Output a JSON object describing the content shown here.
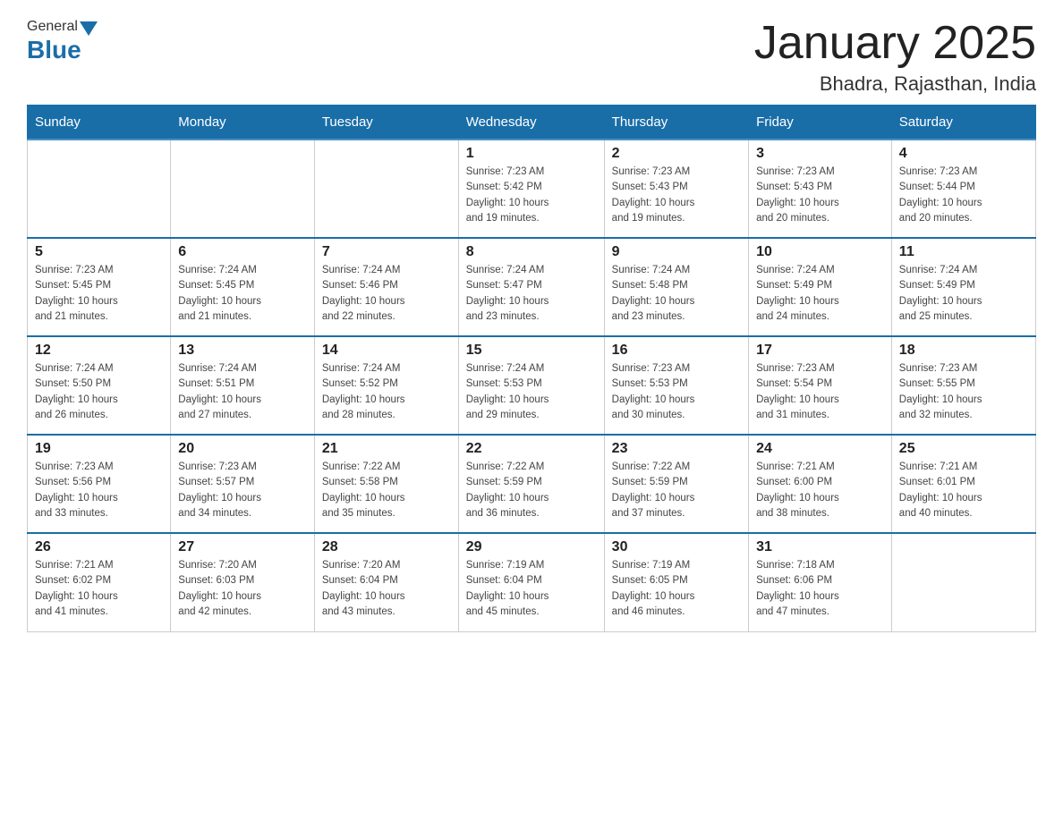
{
  "header": {
    "logo_general": "General",
    "logo_blue": "Blue",
    "month_title": "January 2025",
    "location": "Bhadra, Rajasthan, India"
  },
  "days_of_week": [
    "Sunday",
    "Monday",
    "Tuesday",
    "Wednesday",
    "Thursday",
    "Friday",
    "Saturday"
  ],
  "weeks": [
    [
      {
        "day": "",
        "info": ""
      },
      {
        "day": "",
        "info": ""
      },
      {
        "day": "",
        "info": ""
      },
      {
        "day": "1",
        "info": "Sunrise: 7:23 AM\nSunset: 5:42 PM\nDaylight: 10 hours\nand 19 minutes."
      },
      {
        "day": "2",
        "info": "Sunrise: 7:23 AM\nSunset: 5:43 PM\nDaylight: 10 hours\nand 19 minutes."
      },
      {
        "day": "3",
        "info": "Sunrise: 7:23 AM\nSunset: 5:43 PM\nDaylight: 10 hours\nand 20 minutes."
      },
      {
        "day": "4",
        "info": "Sunrise: 7:23 AM\nSunset: 5:44 PM\nDaylight: 10 hours\nand 20 minutes."
      }
    ],
    [
      {
        "day": "5",
        "info": "Sunrise: 7:23 AM\nSunset: 5:45 PM\nDaylight: 10 hours\nand 21 minutes."
      },
      {
        "day": "6",
        "info": "Sunrise: 7:24 AM\nSunset: 5:45 PM\nDaylight: 10 hours\nand 21 minutes."
      },
      {
        "day": "7",
        "info": "Sunrise: 7:24 AM\nSunset: 5:46 PM\nDaylight: 10 hours\nand 22 minutes."
      },
      {
        "day": "8",
        "info": "Sunrise: 7:24 AM\nSunset: 5:47 PM\nDaylight: 10 hours\nand 23 minutes."
      },
      {
        "day": "9",
        "info": "Sunrise: 7:24 AM\nSunset: 5:48 PM\nDaylight: 10 hours\nand 23 minutes."
      },
      {
        "day": "10",
        "info": "Sunrise: 7:24 AM\nSunset: 5:49 PM\nDaylight: 10 hours\nand 24 minutes."
      },
      {
        "day": "11",
        "info": "Sunrise: 7:24 AM\nSunset: 5:49 PM\nDaylight: 10 hours\nand 25 minutes."
      }
    ],
    [
      {
        "day": "12",
        "info": "Sunrise: 7:24 AM\nSunset: 5:50 PM\nDaylight: 10 hours\nand 26 minutes."
      },
      {
        "day": "13",
        "info": "Sunrise: 7:24 AM\nSunset: 5:51 PM\nDaylight: 10 hours\nand 27 minutes."
      },
      {
        "day": "14",
        "info": "Sunrise: 7:24 AM\nSunset: 5:52 PM\nDaylight: 10 hours\nand 28 minutes."
      },
      {
        "day": "15",
        "info": "Sunrise: 7:24 AM\nSunset: 5:53 PM\nDaylight: 10 hours\nand 29 minutes."
      },
      {
        "day": "16",
        "info": "Sunrise: 7:23 AM\nSunset: 5:53 PM\nDaylight: 10 hours\nand 30 minutes."
      },
      {
        "day": "17",
        "info": "Sunrise: 7:23 AM\nSunset: 5:54 PM\nDaylight: 10 hours\nand 31 minutes."
      },
      {
        "day": "18",
        "info": "Sunrise: 7:23 AM\nSunset: 5:55 PM\nDaylight: 10 hours\nand 32 minutes."
      }
    ],
    [
      {
        "day": "19",
        "info": "Sunrise: 7:23 AM\nSunset: 5:56 PM\nDaylight: 10 hours\nand 33 minutes."
      },
      {
        "day": "20",
        "info": "Sunrise: 7:23 AM\nSunset: 5:57 PM\nDaylight: 10 hours\nand 34 minutes."
      },
      {
        "day": "21",
        "info": "Sunrise: 7:22 AM\nSunset: 5:58 PM\nDaylight: 10 hours\nand 35 minutes."
      },
      {
        "day": "22",
        "info": "Sunrise: 7:22 AM\nSunset: 5:59 PM\nDaylight: 10 hours\nand 36 minutes."
      },
      {
        "day": "23",
        "info": "Sunrise: 7:22 AM\nSunset: 5:59 PM\nDaylight: 10 hours\nand 37 minutes."
      },
      {
        "day": "24",
        "info": "Sunrise: 7:21 AM\nSunset: 6:00 PM\nDaylight: 10 hours\nand 38 minutes."
      },
      {
        "day": "25",
        "info": "Sunrise: 7:21 AM\nSunset: 6:01 PM\nDaylight: 10 hours\nand 40 minutes."
      }
    ],
    [
      {
        "day": "26",
        "info": "Sunrise: 7:21 AM\nSunset: 6:02 PM\nDaylight: 10 hours\nand 41 minutes."
      },
      {
        "day": "27",
        "info": "Sunrise: 7:20 AM\nSunset: 6:03 PM\nDaylight: 10 hours\nand 42 minutes."
      },
      {
        "day": "28",
        "info": "Sunrise: 7:20 AM\nSunset: 6:04 PM\nDaylight: 10 hours\nand 43 minutes."
      },
      {
        "day": "29",
        "info": "Sunrise: 7:19 AM\nSunset: 6:04 PM\nDaylight: 10 hours\nand 45 minutes."
      },
      {
        "day": "30",
        "info": "Sunrise: 7:19 AM\nSunset: 6:05 PM\nDaylight: 10 hours\nand 46 minutes."
      },
      {
        "day": "31",
        "info": "Sunrise: 7:18 AM\nSunset: 6:06 PM\nDaylight: 10 hours\nand 47 minutes."
      },
      {
        "day": "",
        "info": ""
      }
    ]
  ]
}
